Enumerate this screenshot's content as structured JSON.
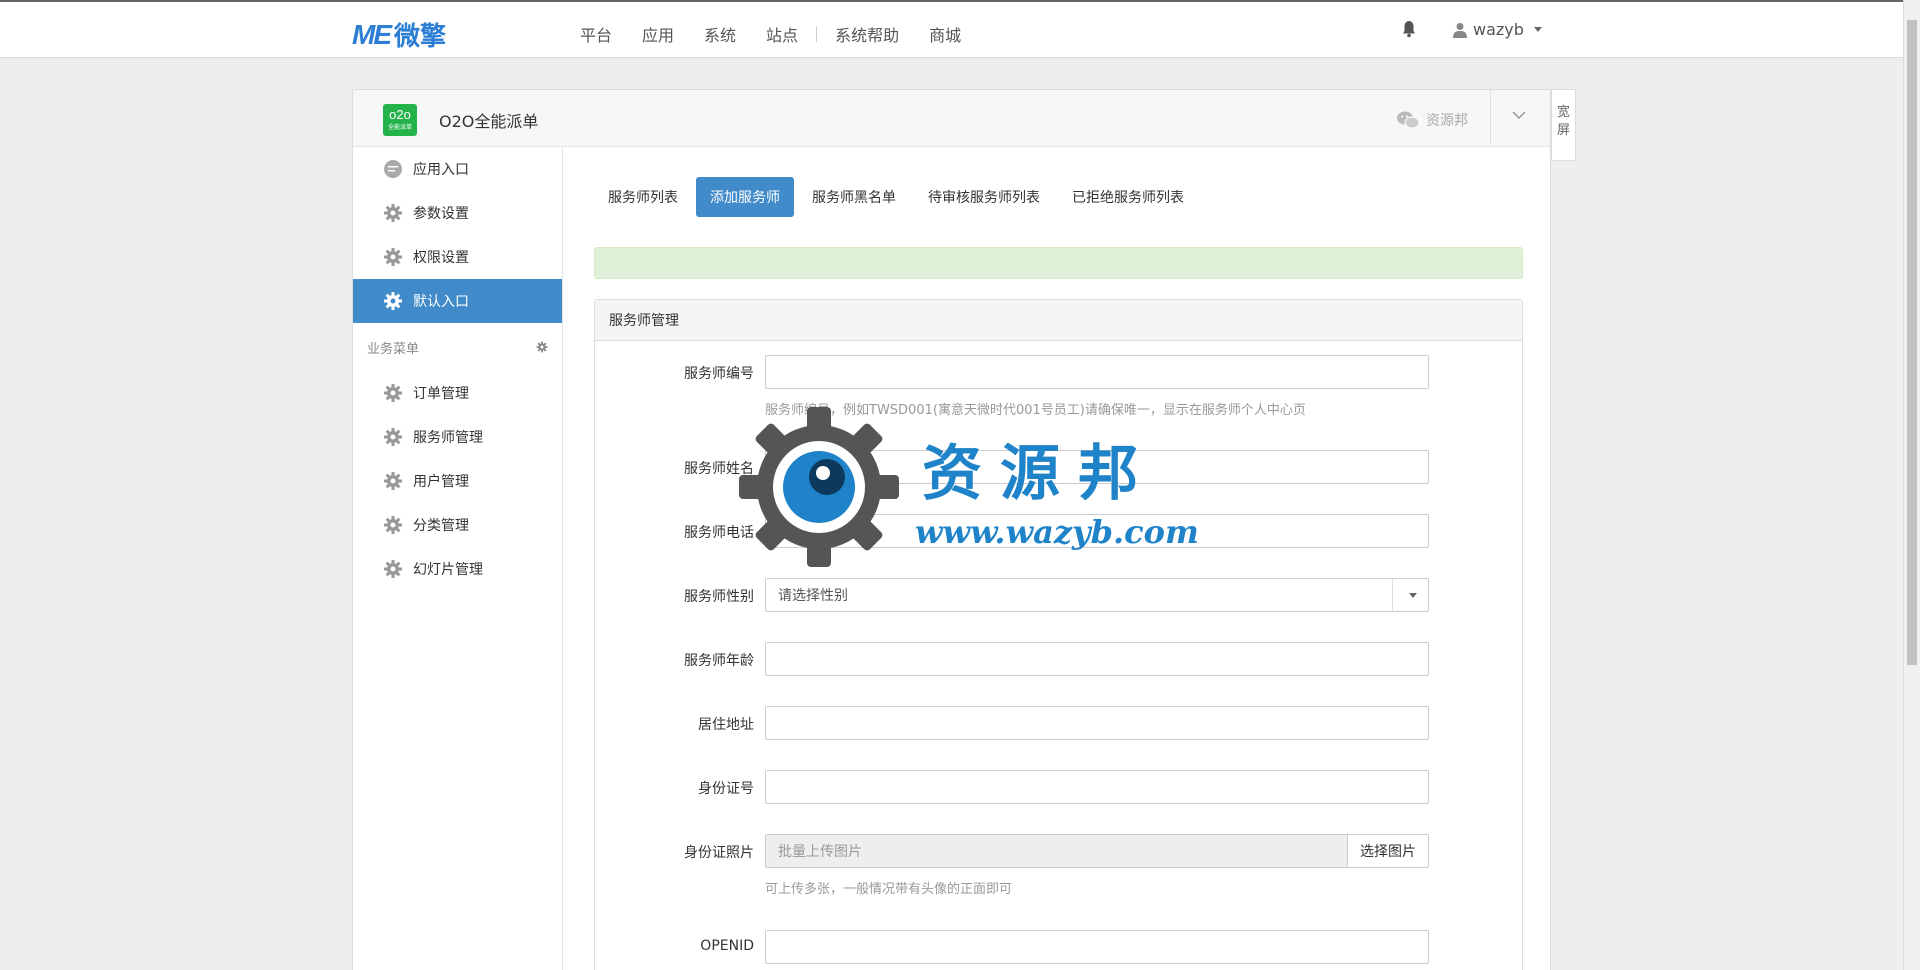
{
  "topbar": {
    "logo_mark": "ME",
    "logo_text": "微擎",
    "nav": [
      "平台",
      "应用",
      "系统",
      "站点",
      "系统帮助",
      "商城"
    ],
    "username": "wazyb"
  },
  "app": {
    "icon_text": "o2o",
    "icon_sub": "全能派单",
    "name": "O2O全能派单",
    "share_label": "资源邦",
    "wide_label": "宽屏"
  },
  "sidebar": {
    "items_top": [
      {
        "label": "应用入口",
        "icon": "chat-icon"
      },
      {
        "label": "参数设置",
        "icon": "gear-icon"
      },
      {
        "label": "权限设置",
        "icon": "gear-icon"
      },
      {
        "label": "默认入口",
        "icon": "gear-icon",
        "active": true
      }
    ],
    "group_label": "业务菜单",
    "items_biz": [
      {
        "label": "订单管理",
        "icon": "gear-icon"
      },
      {
        "label": "服务师管理",
        "icon": "gear-icon"
      },
      {
        "label": "用户管理",
        "icon": "gear-icon"
      },
      {
        "label": "分类管理",
        "icon": "gear-icon"
      },
      {
        "label": "幻灯片管理",
        "icon": "gear-icon"
      }
    ]
  },
  "tabs": [
    "服务师列表",
    "添加服务师",
    "服务师黑名单",
    "待审核服务师列表",
    "已拒绝服务师列表"
  ],
  "form": {
    "title": "服务师管理",
    "fields": {
      "number_label": "服务师编号",
      "number_help": "服务师编号，例如TWSD001(寓意天微时代001号员工)请确保唯一，显示在服务师个人中心页",
      "name_label": "服务师姓名",
      "phone_label": "服务师电话",
      "gender_label": "服务师性别",
      "gender_value": "请选择性别",
      "age_label": "服务师年龄",
      "address_label": "居住地址",
      "idcard_label": "身份证号",
      "idphoto_label": "身份证照片",
      "idphoto_placeholder": "批量上传图片",
      "idphoto_button": "选择图片",
      "idphoto_help": "可上传多张，一般情况带有头像的正面即可",
      "openid_label": "OPENID"
    }
  },
  "watermark": {
    "title": "资源邦",
    "url": "www.wazyb.com"
  }
}
